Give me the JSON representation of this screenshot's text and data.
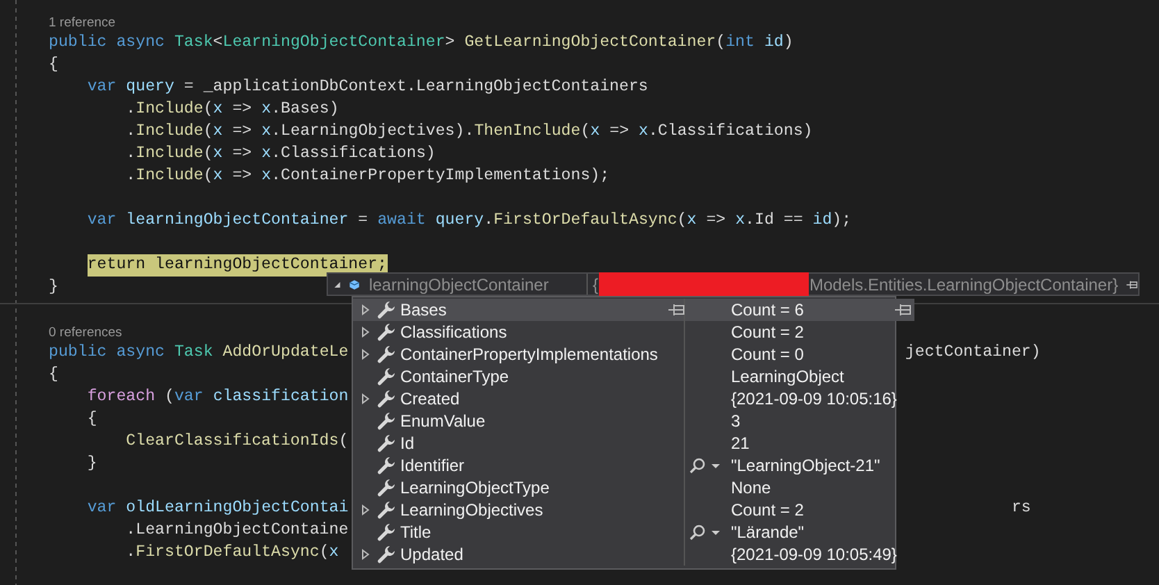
{
  "editor": {
    "lines": [
      {
        "kind": "lens",
        "text": "1 reference"
      },
      {
        "kind": "code",
        "segs": [
          {
            "t": "public async ",
            "kind": "kw"
          },
          {
            "t": "Task",
            "kind": "type"
          },
          {
            "t": "<",
            "kind": "plain"
          },
          {
            "t": "LearningObjectContainer",
            "kind": "type"
          },
          {
            "t": "> ",
            "kind": "plain"
          },
          {
            "t": "GetLearningObjectContainer",
            "kind": "fn"
          },
          {
            "t": "(",
            "kind": "plain"
          },
          {
            "t": "int ",
            "kind": "kw"
          },
          {
            "t": "id",
            "kind": "var"
          },
          {
            "t": ")",
            "kind": "plain"
          }
        ]
      },
      {
        "kind": "code",
        "segs": [
          {
            "t": "{",
            "kind": "plain"
          }
        ]
      },
      {
        "kind": "code",
        "segs": [
          {
            "t": "    var ",
            "kind": "kw"
          },
          {
            "t": "query",
            "kind": "var"
          },
          {
            "t": " = _applicationDbContext.LearningObjectContainers",
            "kind": "plain"
          }
        ]
      },
      {
        "kind": "code",
        "segs": [
          {
            "t": "        .",
            "kind": "plain"
          },
          {
            "t": "Include",
            "kind": "fn"
          },
          {
            "t": "(",
            "kind": "plain"
          },
          {
            "t": "x",
            "kind": "var"
          },
          {
            "t": " => ",
            "kind": "plain"
          },
          {
            "t": "x",
            "kind": "var"
          },
          {
            "t": ".Bases)",
            "kind": "plain"
          }
        ]
      },
      {
        "kind": "code",
        "segs": [
          {
            "t": "        .",
            "kind": "plain"
          },
          {
            "t": "Include",
            "kind": "fn"
          },
          {
            "t": "(",
            "kind": "plain"
          },
          {
            "t": "x",
            "kind": "var"
          },
          {
            "t": " => ",
            "kind": "plain"
          },
          {
            "t": "x",
            "kind": "var"
          },
          {
            "t": ".LearningObjectives).",
            "kind": "plain"
          },
          {
            "t": "ThenInclude",
            "kind": "fn"
          },
          {
            "t": "(",
            "kind": "plain"
          },
          {
            "t": "x",
            "kind": "var"
          },
          {
            "t": " => ",
            "kind": "plain"
          },
          {
            "t": "x",
            "kind": "var"
          },
          {
            "t": ".Classifications)",
            "kind": "plain"
          }
        ]
      },
      {
        "kind": "code",
        "segs": [
          {
            "t": "        .",
            "kind": "plain"
          },
          {
            "t": "Include",
            "kind": "fn"
          },
          {
            "t": "(",
            "kind": "plain"
          },
          {
            "t": "x",
            "kind": "var"
          },
          {
            "t": " => ",
            "kind": "plain"
          },
          {
            "t": "x",
            "kind": "var"
          },
          {
            "t": ".Classifications)",
            "kind": "plain"
          }
        ]
      },
      {
        "kind": "code",
        "segs": [
          {
            "t": "        .",
            "kind": "plain"
          },
          {
            "t": "Include",
            "kind": "fn"
          },
          {
            "t": "(",
            "kind": "plain"
          },
          {
            "t": "x",
            "kind": "var"
          },
          {
            "t": " => ",
            "kind": "plain"
          },
          {
            "t": "x",
            "kind": "var"
          },
          {
            "t": ".ContainerPropertyImplementations);",
            "kind": "plain"
          }
        ]
      },
      {
        "kind": "blank"
      },
      {
        "kind": "code",
        "segs": [
          {
            "t": "    var ",
            "kind": "kw"
          },
          {
            "t": "learningObjectContainer",
            "kind": "var"
          },
          {
            "t": " = ",
            "kind": "plain"
          },
          {
            "t": "await ",
            "kind": "kw"
          },
          {
            "t": "query",
            "kind": "var"
          },
          {
            "t": ".",
            "kind": "plain"
          },
          {
            "t": "FirstOrDefaultAsync",
            "kind": "fn"
          },
          {
            "t": "(",
            "kind": "plain"
          },
          {
            "t": "x",
            "kind": "var"
          },
          {
            "t": " => ",
            "kind": "plain"
          },
          {
            "t": "x",
            "kind": "var"
          },
          {
            "t": ".Id == ",
            "kind": "plain"
          },
          {
            "t": "id",
            "kind": "var"
          },
          {
            "t": ");",
            "kind": "plain"
          }
        ]
      },
      {
        "kind": "blank"
      },
      {
        "kind": "code",
        "current": true,
        "segs": [
          {
            "t": "return learningObjectContainer;",
            "kind": "hl"
          }
        ]
      },
      {
        "kind": "code",
        "segs": [
          {
            "t": "}",
            "kind": "plain"
          }
        ]
      },
      {
        "kind": "separator"
      },
      {
        "kind": "lens",
        "text": "0 references"
      },
      {
        "kind": "code",
        "segs": [
          {
            "t": "public async ",
            "kind": "kw"
          },
          {
            "t": "Task ",
            "kind": "type"
          },
          {
            "t": "AddOrUpdateLe",
            "kind": "fn"
          }
        ],
        "right": [
          {
            "t": "jectContainer)",
            "kind": "plain"
          }
        ]
      },
      {
        "kind": "code",
        "segs": [
          {
            "t": "{",
            "kind": "plain"
          }
        ]
      },
      {
        "kind": "code",
        "segs": [
          {
            "t": "    foreach ",
            "kind": "ctrl"
          },
          {
            "t": "(",
            "kind": "plain"
          },
          {
            "t": "var ",
            "kind": "kw"
          },
          {
            "t": "classification",
            "kind": "var"
          }
        ]
      },
      {
        "kind": "code",
        "segs": [
          {
            "t": "    {",
            "kind": "plain"
          }
        ]
      },
      {
        "kind": "code",
        "segs": [
          {
            "t": "        ClearClassificationIds",
            "kind": "fn"
          },
          {
            "t": "(",
            "kind": "plain"
          }
        ]
      },
      {
        "kind": "code",
        "segs": [
          {
            "t": "    }",
            "kind": "plain"
          }
        ]
      },
      {
        "kind": "blank"
      },
      {
        "kind": "code",
        "segs": [
          {
            "t": "    var ",
            "kind": "kw"
          },
          {
            "t": "oldLearningObjectContai",
            "kind": "var"
          }
        ],
        "right": [
          {
            "t": "rs",
            "kind": "plain"
          }
        ]
      },
      {
        "kind": "code",
        "segs": [
          {
            "t": "        .LearningObjectContaine",
            "kind": "plain"
          }
        ]
      },
      {
        "kind": "code",
        "segs": [
          {
            "t": "        .",
            "kind": "plain"
          },
          {
            "t": "FirstOrDefaultAsync",
            "kind": "fn"
          },
          {
            "t": "(",
            "kind": "plain"
          },
          {
            "t": "x",
            "kind": "var"
          }
        ]
      }
    ]
  },
  "datatip": {
    "name": "learningObjectContainer",
    "expanded": true,
    "value_start": "{",
    "value_end": "Models.Entities.LearningObjectContainer}",
    "redacted": true,
    "members": [
      {
        "name": "Bases",
        "value": "Count = 6",
        "expandable": true,
        "inspect": false,
        "selected": true
      },
      {
        "name": "Classifications",
        "value": "Count = 2",
        "expandable": true,
        "inspect": false,
        "selected": false
      },
      {
        "name": "ContainerPropertyImplementations",
        "value": "Count = 0",
        "expandable": true,
        "inspect": false,
        "selected": false
      },
      {
        "name": "ContainerType",
        "value": "LearningObject",
        "expandable": false,
        "inspect": false,
        "selected": false
      },
      {
        "name": "Created",
        "value": "{2021-09-09 10:05:16}",
        "expandable": true,
        "inspect": false,
        "selected": false
      },
      {
        "name": "EnumValue",
        "value": "3",
        "expandable": false,
        "inspect": false,
        "selected": false
      },
      {
        "name": "Id",
        "value": "21",
        "expandable": false,
        "inspect": false,
        "selected": false
      },
      {
        "name": "Identifier",
        "value": "\"LearningObject-21\"",
        "expandable": false,
        "inspect": true,
        "selected": false
      },
      {
        "name": "LearningObjectType",
        "value": "None",
        "expandable": false,
        "inspect": false,
        "selected": false
      },
      {
        "name": "LearningObjectives",
        "value": "Count = 2",
        "expandable": true,
        "inspect": false,
        "selected": false
      },
      {
        "name": "Title",
        "value": "\"Lärande\"",
        "expandable": false,
        "inspect": true,
        "selected": false
      },
      {
        "name": "Updated",
        "value": "{2021-09-09 10:05:49}",
        "expandable": true,
        "inspect": false,
        "selected": false
      }
    ]
  }
}
